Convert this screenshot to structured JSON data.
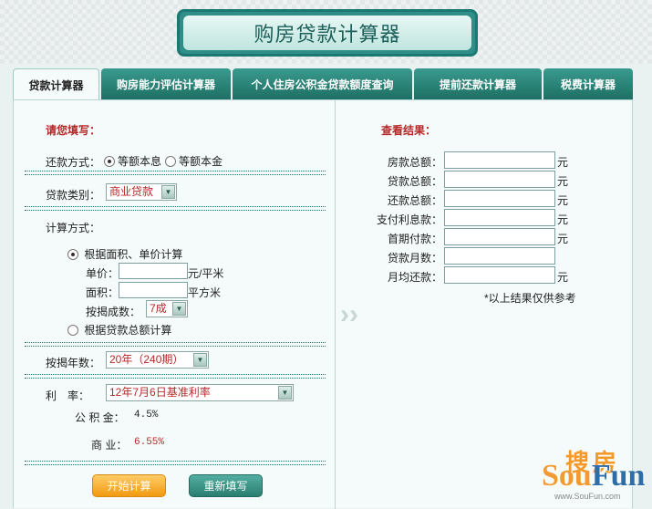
{
  "title": "购房贷款计算器",
  "tabs": [
    "贷款计算器",
    "购房能力评估计算器",
    "个人住房公积金贷款额度查询",
    "提前还款计算器",
    "税费计算器"
  ],
  "left": {
    "heading": "请您填写：",
    "repay_label": "还款方式：",
    "repay_opt1": "等额本息",
    "repay_opt2": "等额本金",
    "loan_type_label": "贷款类别：",
    "loan_type_value": "商业贷款",
    "calc_method_label": "计算方式：",
    "method_opt1": "根据面积、单价计算",
    "price_label": "单价：",
    "price_unit": "元/平米",
    "area_label": "面积：",
    "area_unit": "平方米",
    "ratio_label": "按揭成数：",
    "ratio_value": "7成",
    "method_opt2": "根据贷款总额计算",
    "years_label": "按揭年数：",
    "years_value": "20年（240期）",
    "rate_label": "利　率：",
    "rate_value": "12年7月6日基准利率",
    "fund_label": "公 积 金：",
    "fund_value": "4.5%",
    "biz_label": "商  业：",
    "biz_value": "6.55%",
    "calc_btn": "开始计算",
    "reset_btn": "重新填写"
  },
  "right": {
    "heading": "查看结果：",
    "rows": [
      {
        "label": "房款总额：",
        "unit": "元"
      },
      {
        "label": "贷款总额：",
        "unit": "元"
      },
      {
        "label": "还款总额：",
        "unit": "元"
      },
      {
        "label": "支付利息款：",
        "unit": "元"
      },
      {
        "label": "首期付款：",
        "unit": "元"
      },
      {
        "label": "贷款月数：",
        "unit": ""
      },
      {
        "label": "月均还款：",
        "unit": "元"
      }
    ],
    "note": "*以上结果仅供参考"
  },
  "logo": {
    "zh": "搜房",
    "en1": "Sou",
    "en2": "Fun",
    "url": "www.SouFun.com"
  },
  "colors": {
    "accent": "#2a7e70",
    "label_red": "#b82828",
    "orange": "#f19a11"
  }
}
